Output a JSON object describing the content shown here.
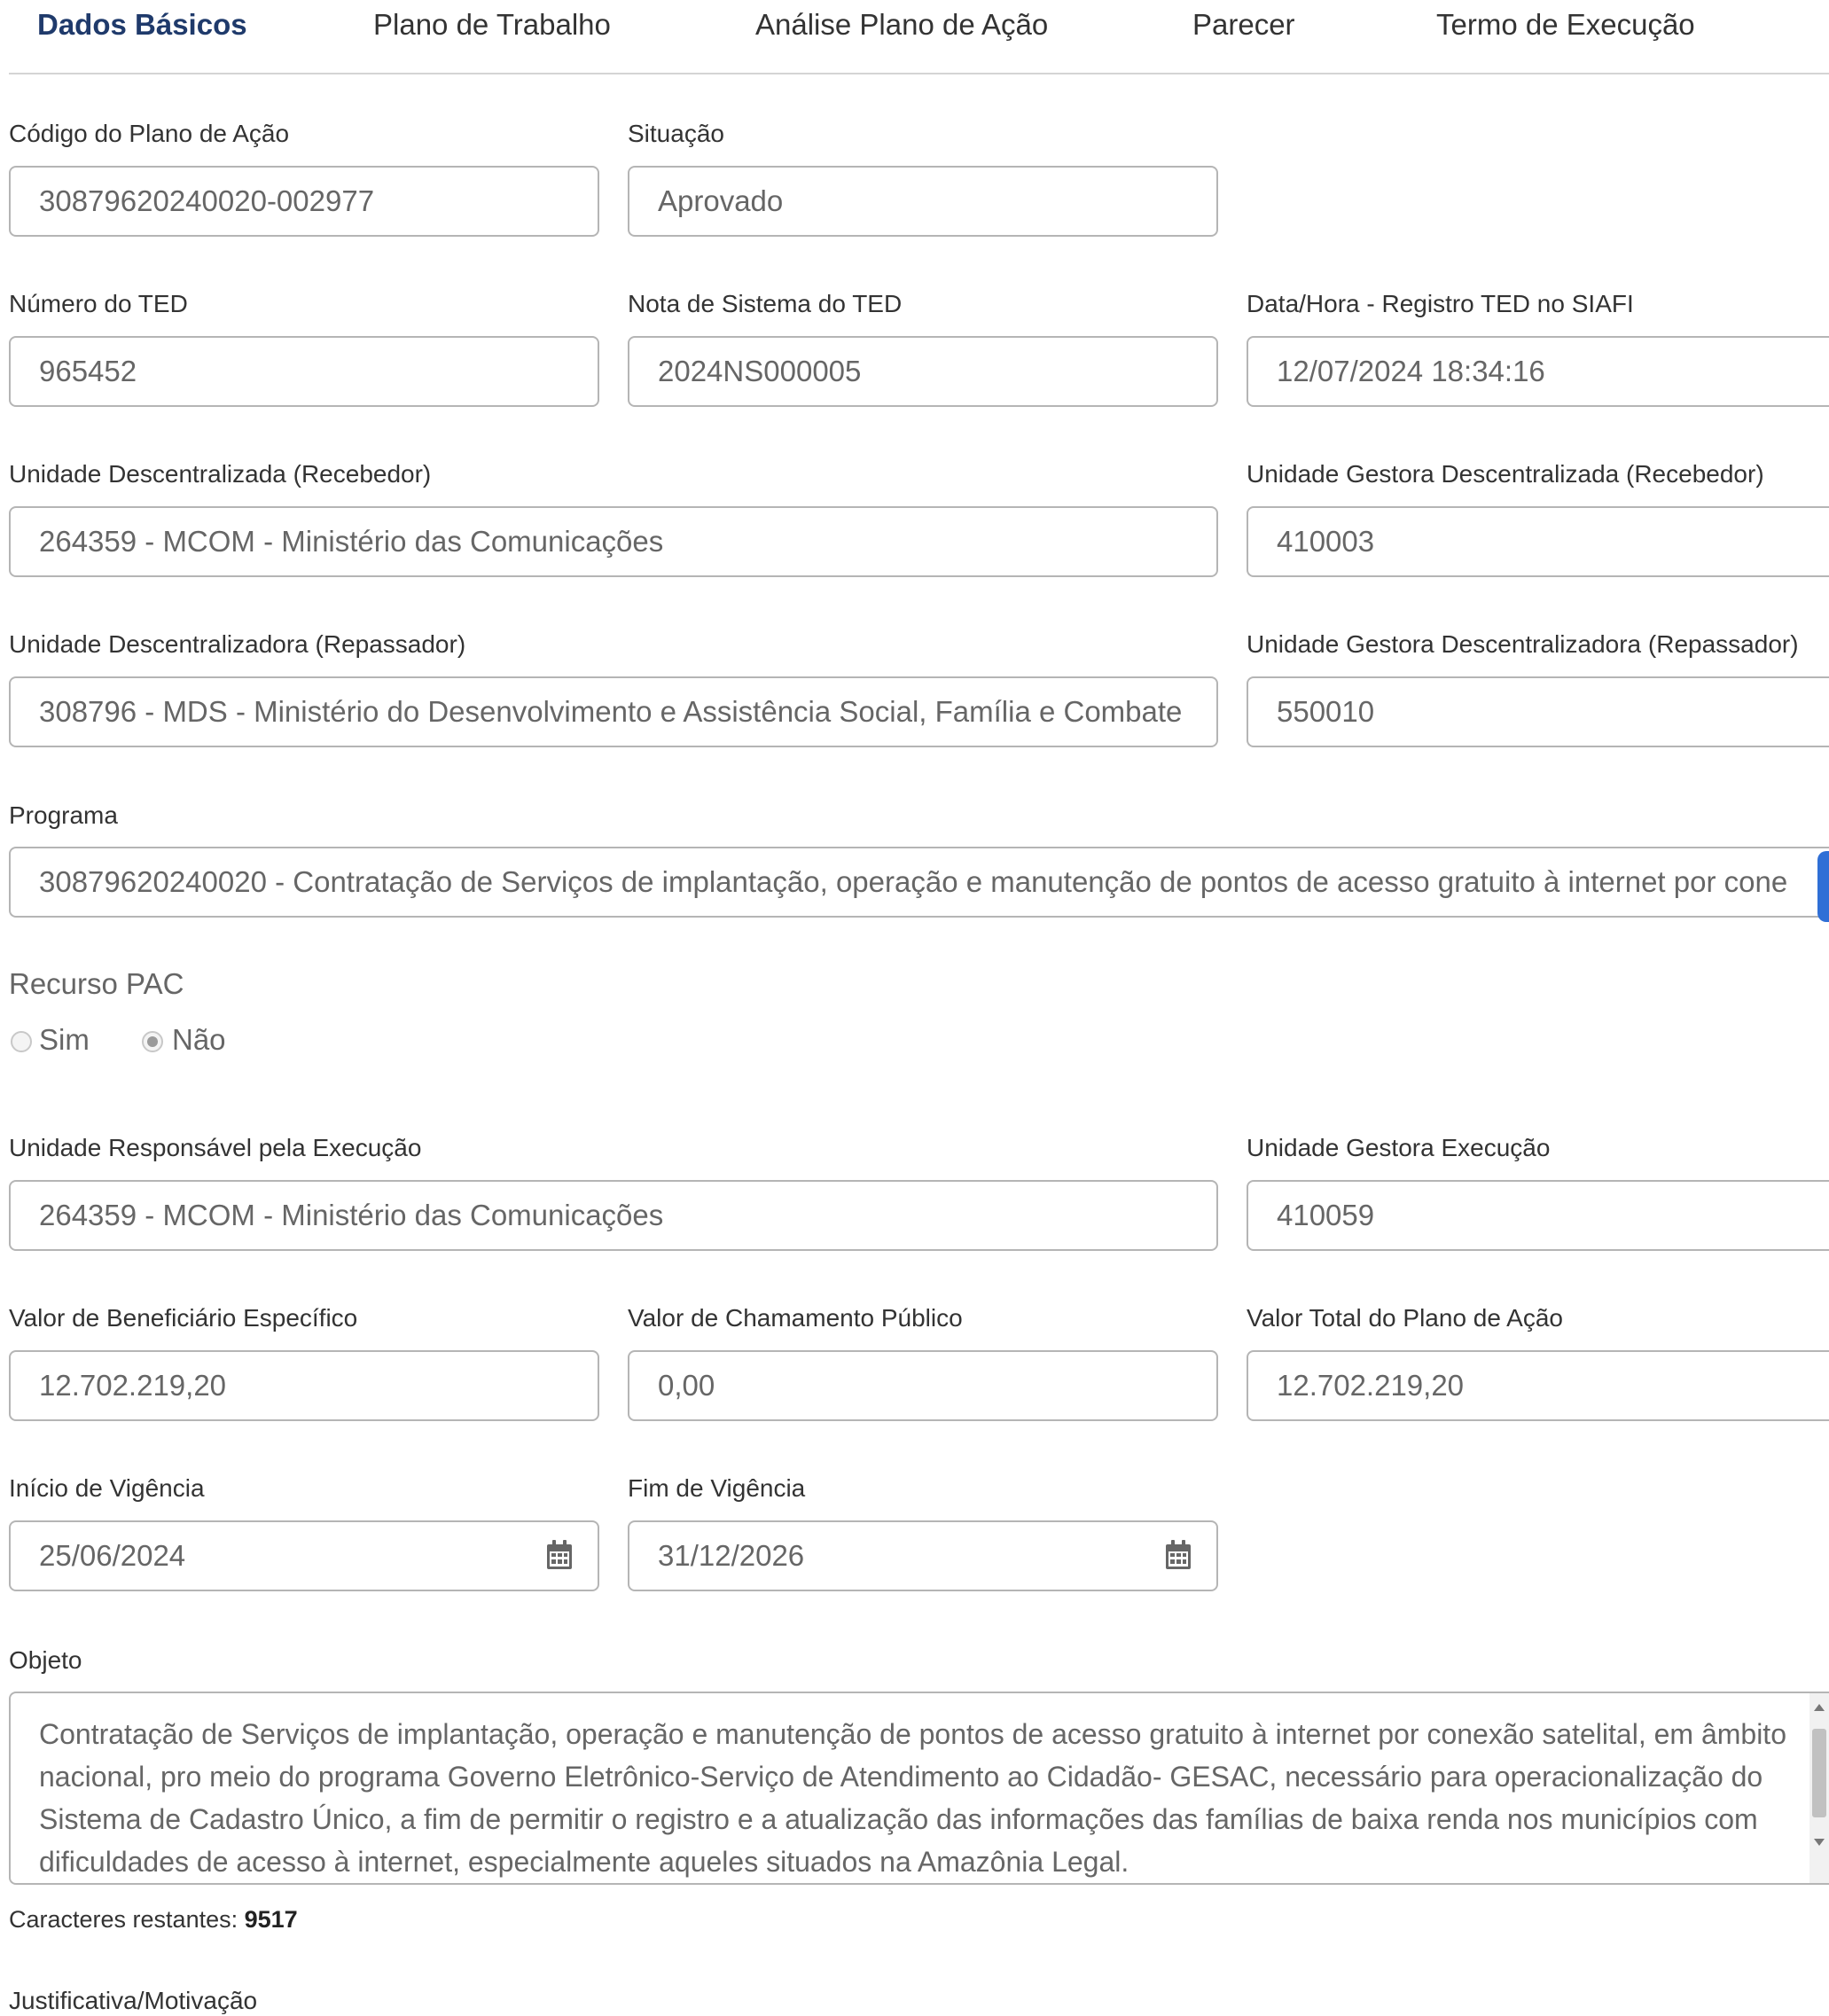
{
  "tabs": [
    {
      "label": "Dados Básicos",
      "active": true
    },
    {
      "label": "Plano de Trabalho",
      "active": false
    },
    {
      "label": "Análise Plano de Ação",
      "active": false
    },
    {
      "label": "Parecer",
      "active": false
    },
    {
      "label": "Termo de Execução",
      "active": false
    }
  ],
  "fields": {
    "codigo_plano": {
      "label": "Código do Plano de Ação",
      "value": "30879620240020-002977"
    },
    "situacao": {
      "label": "Situação",
      "value": "Aprovado"
    },
    "numero_ted": {
      "label": "Número do TED",
      "value": "965452"
    },
    "nota_sistema_ted": {
      "label": "Nota de Sistema do TED",
      "value": "2024NS000005"
    },
    "data_hora_registro": {
      "label": "Data/Hora - Registro TED no SIAFI",
      "value": "12/07/2024 18:34:16"
    },
    "unidade_descentralizada": {
      "label": "Unidade Descentralizada (Recebedor)",
      "value": "264359 - MCOM - Ministério das Comunicações"
    },
    "ug_descentralizada": {
      "label": "Unidade Gestora Descentralizada (Recebedor)",
      "value": "410003"
    },
    "unidade_descentralizadora": {
      "label": "Unidade Descentralizadora (Repassador)",
      "value": "308796 - MDS - Ministério do Desenvolvimento e Assistência Social, Família e Combate"
    },
    "ug_descentralizadora": {
      "label": "Unidade Gestora Descentralizadora (Repassador)",
      "value": "550010"
    },
    "programa": {
      "label": "Programa",
      "value": "30879620240020 - Contratação de Serviços de implantação, operação e manutenção de pontos de acesso gratuito à internet por cone"
    },
    "unidade_responsavel": {
      "label": "Unidade Responsável pela Execução",
      "value": "264359 - MCOM - Ministério das Comunicações"
    },
    "ug_execucao": {
      "label": "Unidade Gestora Execução",
      "value": "410059"
    },
    "valor_beneficiario": {
      "label": "Valor de Beneficiário Específico",
      "value": "12.702.219,20"
    },
    "valor_chamamento": {
      "label": "Valor de Chamamento Público",
      "value": "0,00"
    },
    "valor_total": {
      "label": "Valor Total do Plano de Ação",
      "value": "12.702.219,20"
    },
    "inicio_vigencia": {
      "label": "Início de Vigência",
      "value": "25/06/2024"
    },
    "fim_vigencia": {
      "label": "Fim de Vigência",
      "value": "31/12/2026"
    }
  },
  "recurso_pac": {
    "label": "Recurso PAC",
    "options": [
      {
        "label": "Sim",
        "checked": false
      },
      {
        "label": "Não",
        "checked": true
      }
    ]
  },
  "objeto": {
    "label": "Objeto",
    "value": "Contratação de Serviços de implantação, operação e manutenção de pontos de acesso gratuito à internet por conexão satelital, em âmbito nacional, pro meio do programa Governo Eletrônico-Serviço de Atendimento ao Cidadão- GESAC, necessário para operacionalização do Sistema de Cadastro Único, a fim de permitir o registro e a atualização das informações das famílias de baixa renda nos municípios com dificuldades de acesso à internet, especialmente aqueles situados na Amazônia Legal.",
    "counter_label": "Caracteres restantes:",
    "counter_value": "9517"
  },
  "justificativa": {
    "label": "Justificativa/Motivação"
  },
  "icons": {
    "calendar": "calendar-icon"
  },
  "colors": {
    "active_tab": "#1f3a6b",
    "accent": "#2f6fd6"
  }
}
